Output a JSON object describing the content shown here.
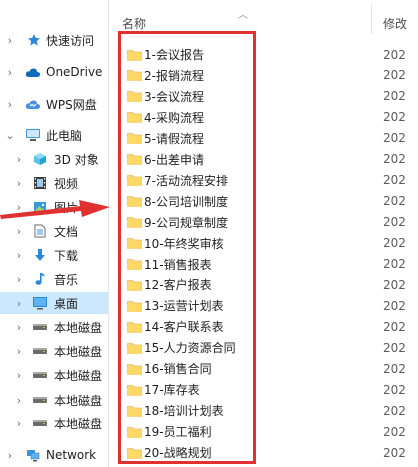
{
  "header": {
    "name_col": "名称",
    "modified_col": "修改"
  },
  "sidebar": {
    "items": [
      {
        "label": "快速访问",
        "icon": "star-icon"
      },
      {
        "label": "OneDrive",
        "icon": "cloud-icon"
      },
      {
        "label": "WPS网盘",
        "icon": "wps-cloud-icon"
      },
      {
        "label": "此电脑",
        "icon": "computer-icon"
      },
      {
        "label": "3D 对象",
        "icon": "cube-icon"
      },
      {
        "label": "视频",
        "icon": "film-icon"
      },
      {
        "label": "图片",
        "icon": "picture-icon"
      },
      {
        "label": "文档",
        "icon": "document-icon"
      },
      {
        "label": "下载",
        "icon": "download-icon"
      },
      {
        "label": "音乐",
        "icon": "music-icon"
      },
      {
        "label": "桌面",
        "icon": "desktop-icon"
      },
      {
        "label": "本地磁盘",
        "icon": "drive-icon"
      },
      {
        "label": "本地磁盘",
        "icon": "drive-icon"
      },
      {
        "label": "本地磁盘",
        "icon": "drive-icon"
      },
      {
        "label": "本地磁盘",
        "icon": "drive-icon"
      },
      {
        "label": "本地磁盘",
        "icon": "drive-icon"
      },
      {
        "label": "Network",
        "icon": "network-icon"
      }
    ]
  },
  "folders": [
    {
      "name": "1-会议报告",
      "date": "202"
    },
    {
      "name": "2-报销流程",
      "date": "202"
    },
    {
      "name": "3-会议流程",
      "date": "202"
    },
    {
      "name": "4-采购流程",
      "date": "202"
    },
    {
      "name": "5-请假流程",
      "date": "202"
    },
    {
      "name": "6-出差申请",
      "date": "202"
    },
    {
      "name": "7-活动流程安排",
      "date": "202"
    },
    {
      "name": "8-公司培训制度",
      "date": "202"
    },
    {
      "name": "9-公司规章制度",
      "date": "202"
    },
    {
      "name": "10-年终奖审核",
      "date": "202"
    },
    {
      "name": "11-销售报表",
      "date": "202"
    },
    {
      "name": "12-客户报表",
      "date": "202"
    },
    {
      "name": "13-运营计划表",
      "date": "202"
    },
    {
      "name": "14-客户联系表",
      "date": "202"
    },
    {
      "name": "15-人力资源合同",
      "date": "202"
    },
    {
      "name": "16-销售合同",
      "date": "202"
    },
    {
      "name": "17-库存表",
      "date": "202"
    },
    {
      "name": "18-培训计划表",
      "date": "202"
    },
    {
      "name": "19-员工福利",
      "date": "202"
    },
    {
      "name": "20-战略规划",
      "date": "202"
    }
  ],
  "colors": {
    "accent_selected": "#cce8ff",
    "folder_yellow": "#f8d775",
    "annotation_red": "#e03131"
  }
}
